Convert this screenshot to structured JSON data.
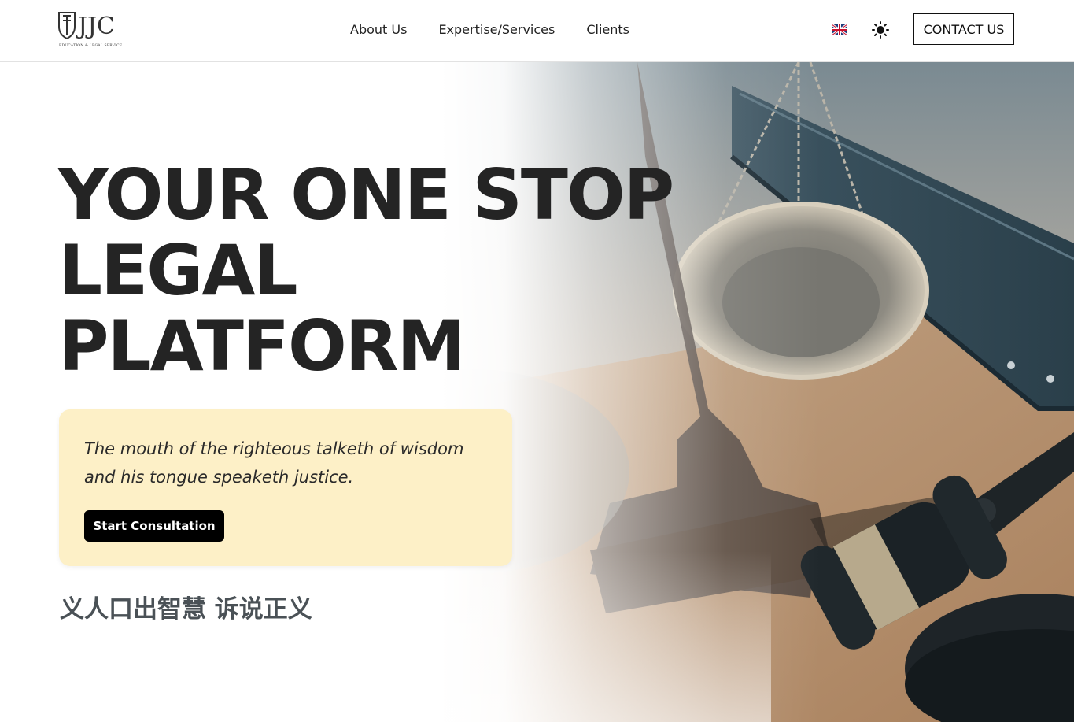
{
  "header": {
    "logo_text": "JJC",
    "logo_tagline": "EDUCATION & LEGAL SERVICE",
    "nav": [
      {
        "label": "About Us"
      },
      {
        "label": "Expertise/Services"
      },
      {
        "label": "Clients"
      }
    ],
    "language_icon": "uk-flag-icon",
    "theme_icon": "sun-icon",
    "contact_label": "CONTACT US"
  },
  "hero": {
    "headline_lines": [
      "YOUR ONE STOP",
      "LEGAL",
      "PLATFORM"
    ],
    "quote_lines": [
      "The mouth of the righteous talketh of wisdom",
      "and his tongue speaketh justice."
    ],
    "cta_label": "Start Consultation",
    "chinese_text": "义人口出智慧 诉说正义",
    "image": "scales-of-justice-and-gavel-photo"
  },
  "colors": {
    "text_dark": "#242424",
    "quote_card_bg": "#fdf0c7",
    "cta_bg": "#000000",
    "chinese_text": "#4a5156"
  }
}
